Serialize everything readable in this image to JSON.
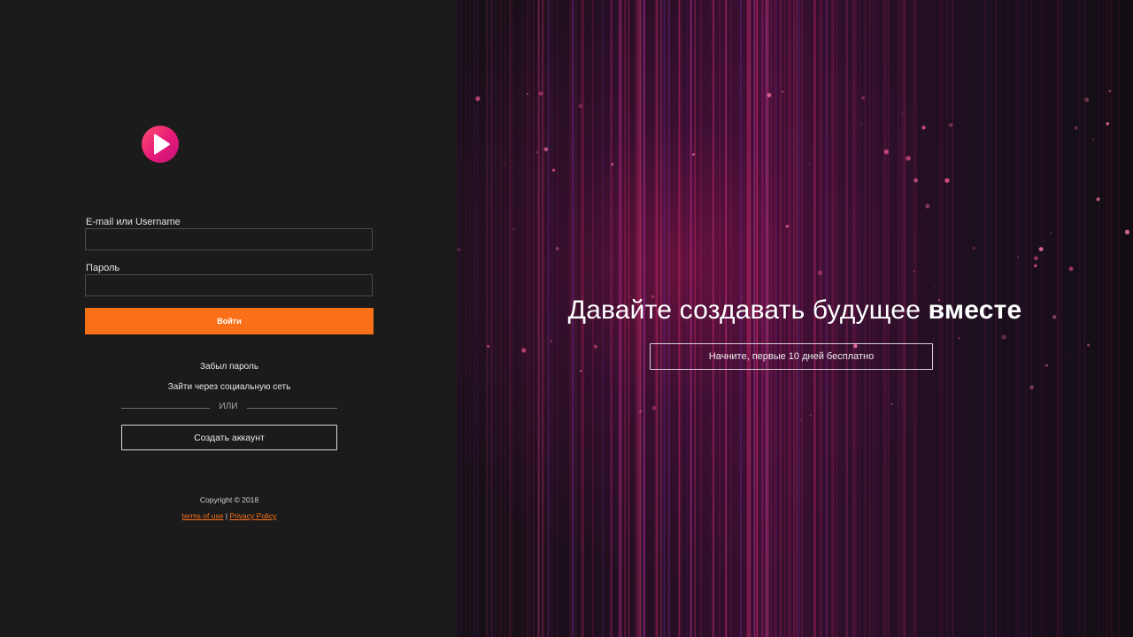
{
  "brand": {
    "logo_icon": "play-icon",
    "accent_color": "#fa7019",
    "logo_colors": [
      "#ff4f6e",
      "#c4127a"
    ]
  },
  "login_form": {
    "username_label": "E-mail или Username",
    "username_value": "",
    "password_label": "Пароль",
    "password_value": "",
    "submit_label": "Войти",
    "forgot_password": "Забыл пароль",
    "social_login": "Зайти через социальную сеть",
    "or_divider": "ИЛИ",
    "create_account": "Создать аккаунт"
  },
  "footer": {
    "copyright": "Copyright © 2018",
    "terms": "terms of use",
    "separator": "|",
    "privacy": "Privacy Policy"
  },
  "hero": {
    "title_main": "Давайте создавать будущее",
    "title_emphasis": "вместе",
    "cta": "Начните, первые 10 дней бесплатно"
  }
}
